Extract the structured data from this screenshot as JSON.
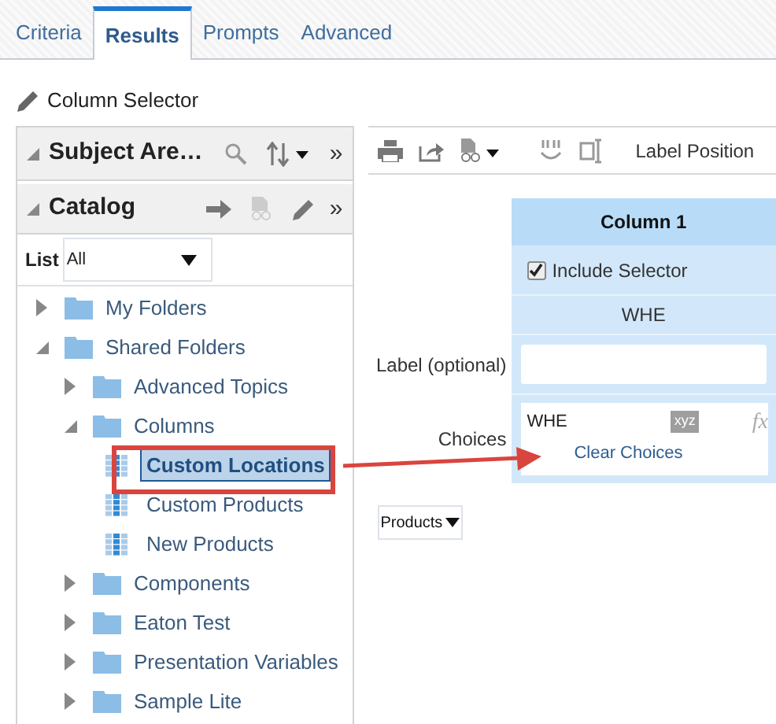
{
  "tabs": [
    {
      "label": "Criteria",
      "selected": false
    },
    {
      "label": "Results",
      "selected": true
    },
    {
      "label": "Prompts",
      "selected": false
    },
    {
      "label": "Advanced",
      "selected": false
    }
  ],
  "column_selector": {
    "title": "Column Selector"
  },
  "subject_areas": {
    "title": "Subject Are…",
    "expanded": true,
    "expand_symbol": "»"
  },
  "catalog": {
    "title": "Catalog",
    "expanded": true,
    "expand_symbol": "»",
    "list_label": "List",
    "list_value": "All",
    "tree": [
      {
        "kind": "folder",
        "label": "My Folders",
        "expanded": false
      },
      {
        "kind": "folder",
        "label": "Shared Folders",
        "expanded": true,
        "children": [
          {
            "kind": "folder",
            "label": "Advanced Topics",
            "expanded": false
          },
          {
            "kind": "folder",
            "label": "Columns",
            "expanded": true,
            "children": [
              {
                "kind": "column",
                "label": "Custom Locations",
                "selected": true
              },
              {
                "kind": "column",
                "label": "Custom Products",
                "selected": false
              },
              {
                "kind": "column",
                "label": "New Products",
                "selected": false
              }
            ]
          },
          {
            "kind": "folder",
            "label": "Components",
            "expanded": false
          },
          {
            "kind": "folder",
            "label": "Eaton Test",
            "expanded": false
          },
          {
            "kind": "folder",
            "label": "Presentation Variables",
            "expanded": false
          },
          {
            "kind": "folder",
            "label": "Sample Lite",
            "expanded": false
          }
        ]
      }
    ]
  },
  "toolbar": {
    "label_position": "Label Position"
  },
  "editor": {
    "column_header": "Column 1",
    "include_selector": {
      "label": "Include Selector",
      "checked": true
    },
    "column_value": "WHE",
    "label_field": {
      "label": "Label (optional)"
    },
    "choices": {
      "label": "Choices",
      "value": "WHE",
      "xyz": "xyz",
      "fx": "fx",
      "clear": "Clear Choices"
    },
    "dropdown": "Products"
  }
}
